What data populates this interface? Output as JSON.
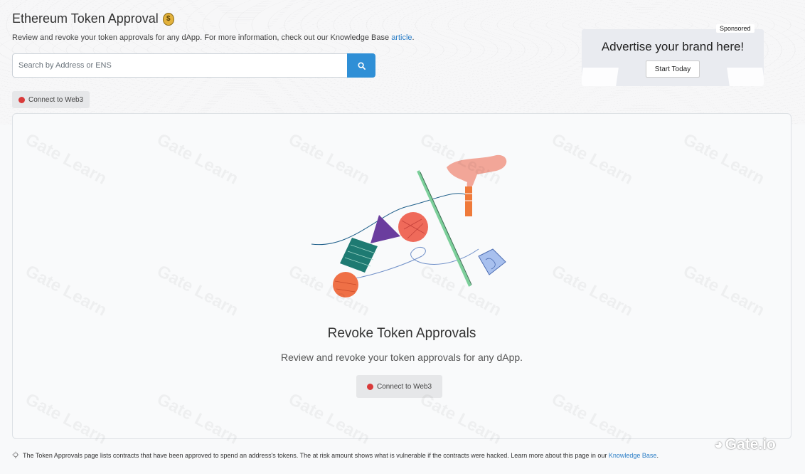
{
  "header": {
    "title": "Ethereum Token Approval",
    "title_icon": "moneybag-icon",
    "subtitle_prefix": "Review and revoke your token approvals for any dApp. For more information, check out our Knowledge Base ",
    "subtitle_link": "article",
    "subtitle_suffix": "."
  },
  "search": {
    "placeholder": "Search by Address or ENS",
    "value": "",
    "button_icon": "search-icon"
  },
  "connect_button": {
    "label": "Connect to Web3",
    "status_color": "#d93a3a"
  },
  "ad": {
    "sponsored_label": "Sponsored",
    "headline": "Advertise your brand here!",
    "cta_label": "Start Today"
  },
  "main": {
    "title": "Revoke Token Approvals",
    "subtitle": "Review and revoke your token approvals for any dApp.",
    "connect_label": "Connect to Web3"
  },
  "footer": {
    "icon": "lightbulb-icon",
    "text": "The Token Approvals page lists contracts that have been approved to spend an address's tokens. The at risk amount shows what is vulnerable if the contracts were hacked. Learn more about this page in our ",
    "link": "Knowledge Base",
    "suffix": "."
  },
  "watermark": {
    "text": "Gate Learn"
  },
  "brand": {
    "text": "Gate.io"
  },
  "colors": {
    "accent": "#2f8fd6",
    "link": "#2b7ec7",
    "status_red": "#d93a3a"
  }
}
